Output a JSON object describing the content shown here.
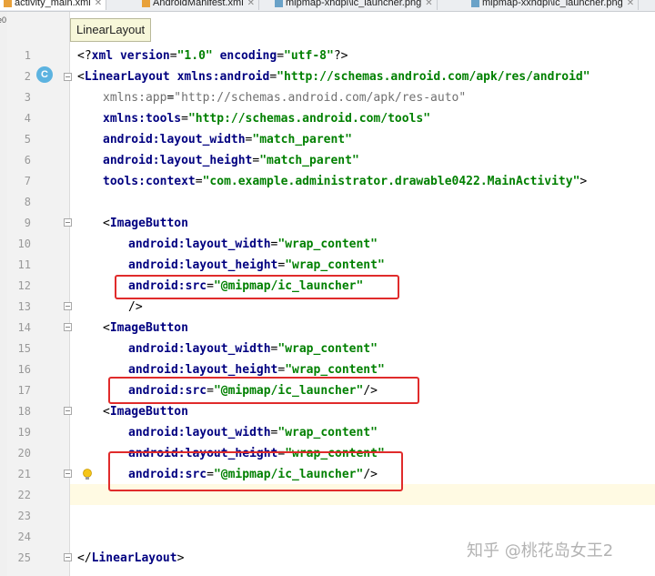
{
  "tabs": [
    {
      "label": "activity_main.xml",
      "active": true
    },
    {
      "label": "AndroidManifest.xml",
      "active": false
    },
    {
      "label": "mipmap-xhdpi\\ic_launcher.png",
      "active": false
    },
    {
      "label": "mipmap-xxhdpi\\ic_launcher.png",
      "active": false
    }
  ],
  "left_strip_label": "e0",
  "tooltip": "LinearLayout",
  "line_numbers": [
    "1",
    "2",
    "3",
    "4",
    "5",
    "6",
    "7",
    "8",
    "9",
    "10",
    "11",
    "12",
    "13",
    "14",
    "15",
    "16",
    "17",
    "18",
    "19",
    "20",
    "21",
    "22",
    "23",
    "24",
    "25"
  ],
  "code": {
    "l1_open": "<?",
    "l1_xml": "xml",
    "l1_version_attr": "version",
    "l1_eq": "=",
    "l1_version_val": "\"1.0\"",
    "l1_enc_attr": "encoding",
    "l1_enc_val": "\"utf-8\"",
    "l1_close": "?>",
    "l2_lt": "<",
    "l2_tag": "LinearLayout",
    "l2_ns": "xmlns:",
    "l2_attr": "android",
    "l2_val": "\"http://schemas.android.com/apk/res/android\"",
    "l3_ns": "xmlns:",
    "l3_attr": "app",
    "l3_val": "\"http://schemas.android.com/apk/res-auto\"",
    "l4_ns": "xmlns:",
    "l4_attr": "tools",
    "l4_val": "\"http://schemas.android.com/tools\"",
    "l5_ns": "android:",
    "l5_attr": "layout_width",
    "l5_val": "\"match_parent\"",
    "l6_ns": "android:",
    "l6_attr": "layout_height",
    "l6_val": "\"match_parent\"",
    "l7_ns": "tools:",
    "l7_attr": "context",
    "l7_val": "\"com.example.administrator.drawable0422.MainActivity\"",
    "l7_close": ">",
    "l9_tag": "ImageButton",
    "l10_ns": "android:",
    "l10_attr": "layout_width",
    "l10_val": "\"wrap_content\"",
    "l11_ns": "android:",
    "l11_attr": "layout_height",
    "l11_val": "\"wrap_content\"",
    "l12_ns": "android:",
    "l12_attr": "src",
    "l12_val": "\"@mipmap/ic_launcher\"",
    "l13_close": "/>",
    "l14_tag": "ImageButton",
    "l15_ns": "android:",
    "l15_attr": "layout_width",
    "l15_val": "\"wrap_content\"",
    "l16_ns": "android:",
    "l16_attr": "layout_height",
    "l16_val": "\"wrap_content\"",
    "l17_ns": "android:",
    "l17_attr": "src",
    "l17_val": "\"@mipmap/ic_launcher\"",
    "l17_close": "/>",
    "l18_tag": "ImageButton",
    "l19_ns": "android:",
    "l19_attr": "layout_width",
    "l19_val": "\"wrap_content\"",
    "l20_ns": "android:",
    "l20_attr": "layout_height",
    "l20_val": "\"wrap_content\"",
    "l21_ns": "android:",
    "l21_attr": "src",
    "l21_val": "\"@mipmap/ic_launcher\"",
    "l21_close": "/>",
    "l25_open": "</",
    "l25_tag": "LinearLayout",
    "l25_close": ">"
  },
  "gutter_badge": "C",
  "watermark": "知乎 @桃花岛女王2",
  "colors": {
    "tag": "#000080",
    "attribute": "#008000",
    "highlight_box": "#e02b2b",
    "current_line": "#fffae3"
  }
}
